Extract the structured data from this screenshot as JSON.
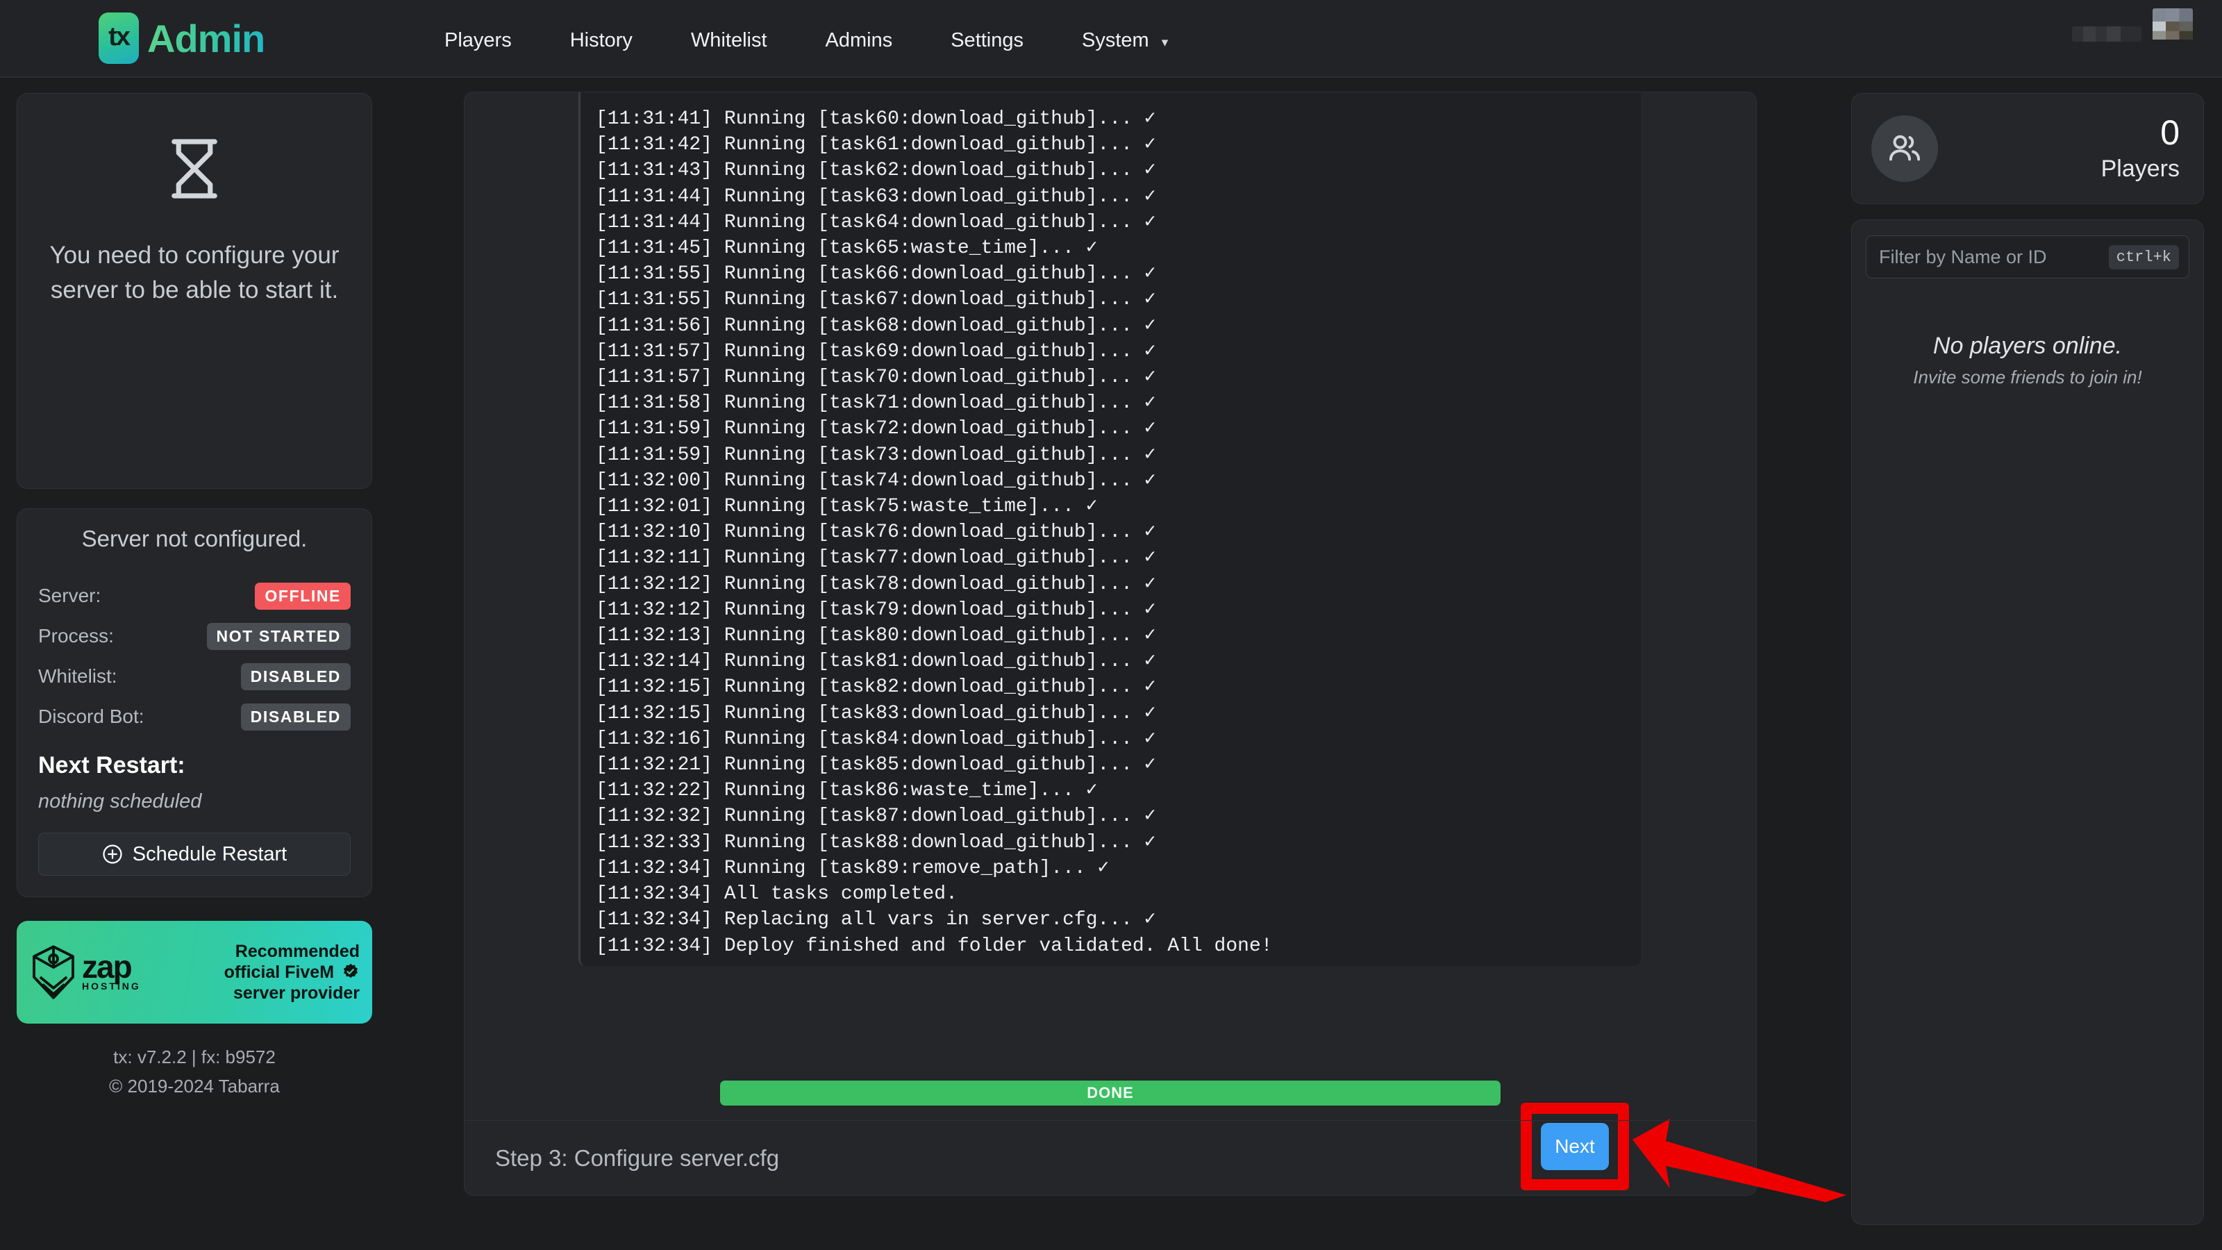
{
  "header": {
    "brand_mark": "tx",
    "brand_text": "Admin",
    "nav": [
      {
        "label": "Players",
        "icon": ""
      },
      {
        "label": "History",
        "icon": ""
      },
      {
        "label": "Whitelist",
        "icon": ""
      },
      {
        "label": "Admins",
        "icon": ""
      },
      {
        "label": "Settings",
        "icon": ""
      },
      {
        "label": "System",
        "icon": "chevron-down-icon",
        "caret": "⌄"
      }
    ]
  },
  "left_sidebar": {
    "configure_card": {
      "icon": "hourglass-icon",
      "message": "You need to configure your server to be able to start it."
    },
    "status_card": {
      "title": "Server not configured.",
      "rows": [
        {
          "label": "Server:",
          "value": "OFFLINE",
          "tone": "danger"
        },
        {
          "label": "Process:",
          "value": "NOT STARTED",
          "tone": "muted"
        },
        {
          "label": "Whitelist:",
          "value": "DISABLED",
          "tone": "muted"
        },
        {
          "label": "Discord Bot:",
          "value": "DISABLED",
          "tone": "muted"
        }
      ],
      "next_restart_title": "Next Restart:",
      "next_restart_value": "nothing scheduled",
      "schedule_button": "Schedule Restart",
      "schedule_button_icon": "plus-circle-icon"
    },
    "ad_banner": {
      "logo_icon": "zap-hosting-cube-icon",
      "wordmark": "zap",
      "sub_wordmark": "HOSTING",
      "line1": "Recommended",
      "line2": "official FiveM",
      "line3": "server provider",
      "verified_icon": "verified-badge-icon"
    },
    "footer": {
      "versions": "tx: v7.2.2 | fx: b9572",
      "copyright": "© 2019-2024 Tabarra"
    }
  },
  "main": {
    "console_lines": [
      "[11:31:41] Running [task60:download_github]... ✓",
      "[11:31:42] Running [task61:download_github]... ✓",
      "[11:31:43] Running [task62:download_github]... ✓",
      "[11:31:44] Running [task63:download_github]... ✓",
      "[11:31:44] Running [task64:download_github]... ✓",
      "[11:31:45] Running [task65:waste_time]... ✓",
      "[11:31:55] Running [task66:download_github]... ✓",
      "[11:31:55] Running [task67:download_github]... ✓",
      "[11:31:56] Running [task68:download_github]... ✓",
      "[11:31:57] Running [task69:download_github]... ✓",
      "[11:31:57] Running [task70:download_github]... ✓",
      "[11:31:58] Running [task71:download_github]... ✓",
      "[11:31:59] Running [task72:download_github]... ✓",
      "[11:31:59] Running [task73:download_github]... ✓",
      "[11:32:00] Running [task74:download_github]... ✓",
      "[11:32:01] Running [task75:waste_time]... ✓",
      "[11:32:10] Running [task76:download_github]... ✓",
      "[11:32:11] Running [task77:download_github]... ✓",
      "[11:32:12] Running [task78:download_github]... ✓",
      "[11:32:12] Running [task79:download_github]... ✓",
      "[11:32:13] Running [task80:download_github]... ✓",
      "[11:32:14] Running [task81:download_github]... ✓",
      "[11:32:15] Running [task82:download_github]... ✓",
      "[11:32:15] Running [task83:download_github]... ✓",
      "[11:32:16] Running [task84:download_github]... ✓",
      "[11:32:21] Running [task85:download_github]... ✓",
      "[11:32:22] Running [task86:waste_time]... ✓",
      "[11:32:32] Running [task87:download_github]... ✓",
      "[11:32:33] Running [task88:download_github]... ✓",
      "[11:32:34] Running [task89:remove_path]... ✓",
      "[11:32:34] All tasks completed.",
      "[11:32:34] Replacing all vars in server.cfg... ✓",
      "[11:32:34] Deploy finished and folder validated. All done!"
    ],
    "progress": {
      "label": "DONE",
      "percent": 100,
      "color": "#3cbe63"
    },
    "next_button": {
      "label": "Next",
      "color": "#3c9ef4"
    },
    "annotation": {
      "highlight_color": "#ef0000",
      "arrow_icon": "arrow-left-icon"
    },
    "step_label": "Step 3: Configure server.cfg"
  },
  "right_sidebar": {
    "players_card": {
      "icon": "players-group-icon",
      "count": "0",
      "label": "Players"
    },
    "filter": {
      "placeholder": "Filter by Name or ID",
      "value": "",
      "shortcut": "ctrl+k"
    },
    "empty_state": {
      "title": "No players online.",
      "subtitle": "Invite some friends to join in!"
    }
  }
}
